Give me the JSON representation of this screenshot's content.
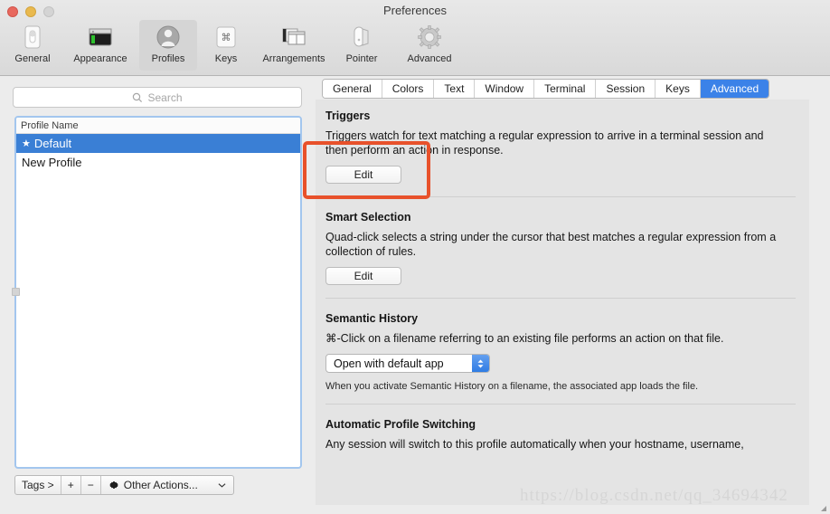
{
  "window": {
    "title": "Preferences",
    "traffic_lights": [
      "close-button",
      "minimize-button",
      "zoom-button"
    ]
  },
  "toolbar": {
    "items": [
      {
        "label": "General",
        "icon": "general-icon",
        "selected": false
      },
      {
        "label": "Appearance",
        "icon": "appearance-icon",
        "selected": false
      },
      {
        "label": "Profiles",
        "icon": "profiles-icon",
        "selected": true
      },
      {
        "label": "Keys",
        "icon": "keys-icon",
        "selected": false
      },
      {
        "label": "Arrangements",
        "icon": "arrangements-icon",
        "selected": false
      },
      {
        "label": "Pointer",
        "icon": "pointer-icon",
        "selected": false
      },
      {
        "label": "Advanced",
        "icon": "advanced-gear-icon",
        "selected": false
      }
    ]
  },
  "sidebar": {
    "search": {
      "placeholder": "Search",
      "value": "",
      "icon": "search-icon"
    },
    "list": {
      "column_header": "Profile Name",
      "rows": [
        {
          "star": "★",
          "name": "Default",
          "selected": true
        },
        {
          "star": "",
          "name": "New Profile",
          "selected": false
        }
      ]
    },
    "bottom_bar": {
      "tags_label": "Tags >",
      "add_label": "+",
      "remove_label": "−",
      "other_actions_label": "Other Actions...",
      "gear_icon": "gear-icon",
      "chevron_icon": "chevron-down-icon"
    }
  },
  "tabs": [
    {
      "label": "General",
      "active": false
    },
    {
      "label": "Colors",
      "active": false
    },
    {
      "label": "Text",
      "active": false
    },
    {
      "label": "Window",
      "active": false
    },
    {
      "label": "Terminal",
      "active": false
    },
    {
      "label": "Session",
      "active": false
    },
    {
      "label": "Keys",
      "active": false
    },
    {
      "label": "Advanced",
      "active": true
    }
  ],
  "sections": {
    "triggers": {
      "title": "Triggers",
      "description": "Triggers watch for text matching a regular expression to arrive in a terminal session and then perform an action in response.",
      "button_label": "Edit"
    },
    "smart_selection": {
      "title": "Smart Selection",
      "description": "Quad-click selects a string under the cursor that best matches a regular expression from a collection of rules.",
      "button_label": "Edit"
    },
    "semantic_history": {
      "title": "Semantic History",
      "description": "⌘-Click on a filename referring to an existing file performs an action on that file.",
      "popup_value": "Open with default app",
      "note": "When you activate Semantic History on a filename, the associated app loads the file."
    },
    "automatic_profile_switching": {
      "title": "Automatic Profile Switching",
      "description": "Any session will switch to this profile automatically when your hostname, username,"
    }
  },
  "annotation": {
    "name": "highlight-rectangle",
    "color": "#e8512b"
  },
  "watermark": {
    "text": "https://blog.csdn.net/qq_34694342"
  },
  "colors": {
    "accent_blue": "#3b82e8",
    "selection_blue": "#3a7fd5",
    "annotation_orange": "#e8512b",
    "window_bg": "#ececec",
    "content_bg": "#e4e4e4"
  }
}
